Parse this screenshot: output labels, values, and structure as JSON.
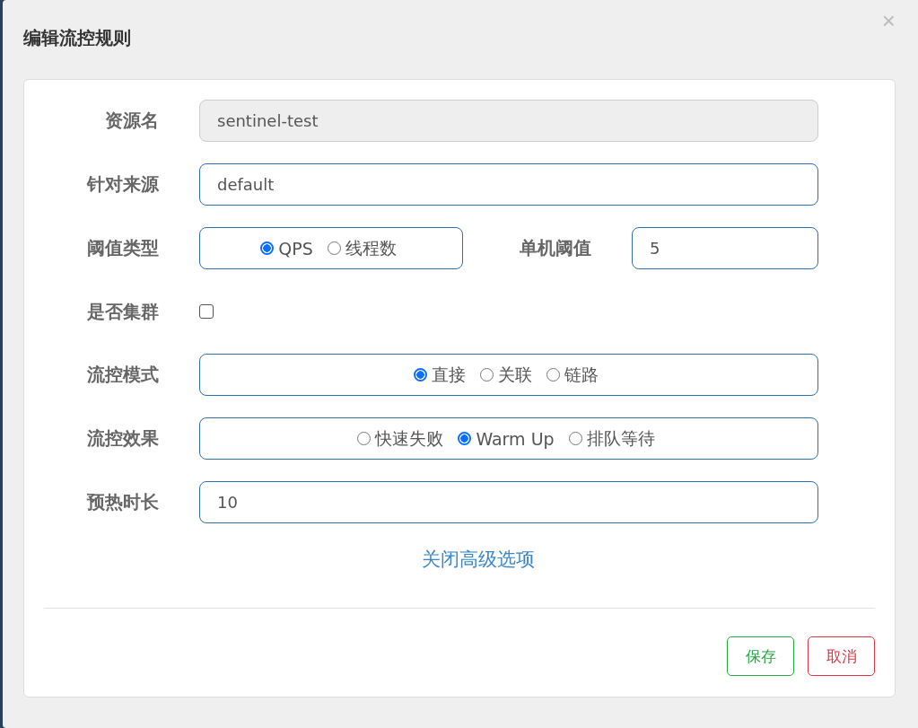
{
  "dialog": {
    "title": "编辑流控规则",
    "close": "×"
  },
  "fields": [
    {
      "kind": "text",
      "label": "资源名",
      "value": "sentinel-test",
      "disabled": true
    },
    {
      "kind": "text",
      "label": "针对来源",
      "value": "default",
      "disabled": false
    },
    {
      "kind": "radio-side",
      "label": "阈值类型",
      "options": [
        {
          "label": "QPS",
          "selected": true
        },
        {
          "label": "线程数",
          "selected": false
        }
      ],
      "side": {
        "label": "单机阈值",
        "value": "5"
      }
    },
    {
      "kind": "checkbox",
      "label": "是否集群",
      "checked": false
    },
    {
      "kind": "radio",
      "label": "流控模式",
      "options": [
        {
          "label": "直接",
          "selected": true
        },
        {
          "label": "关联",
          "selected": false
        },
        {
          "label": "链路",
          "selected": false
        }
      ]
    },
    {
      "kind": "radio",
      "label": "流控效果",
      "options": [
        {
          "label": "快速失败",
          "selected": false
        },
        {
          "label": "Warm Up",
          "selected": true
        },
        {
          "label": "排队等待",
          "selected": false
        }
      ]
    },
    {
      "kind": "text",
      "label": "预热时长",
      "value": "10",
      "disabled": false
    }
  ],
  "toggle_link": "关闭高级选项",
  "buttons": [
    {
      "label": "保存",
      "kind": "save"
    },
    {
      "label": "取消",
      "kind": "cancel"
    }
  ]
}
